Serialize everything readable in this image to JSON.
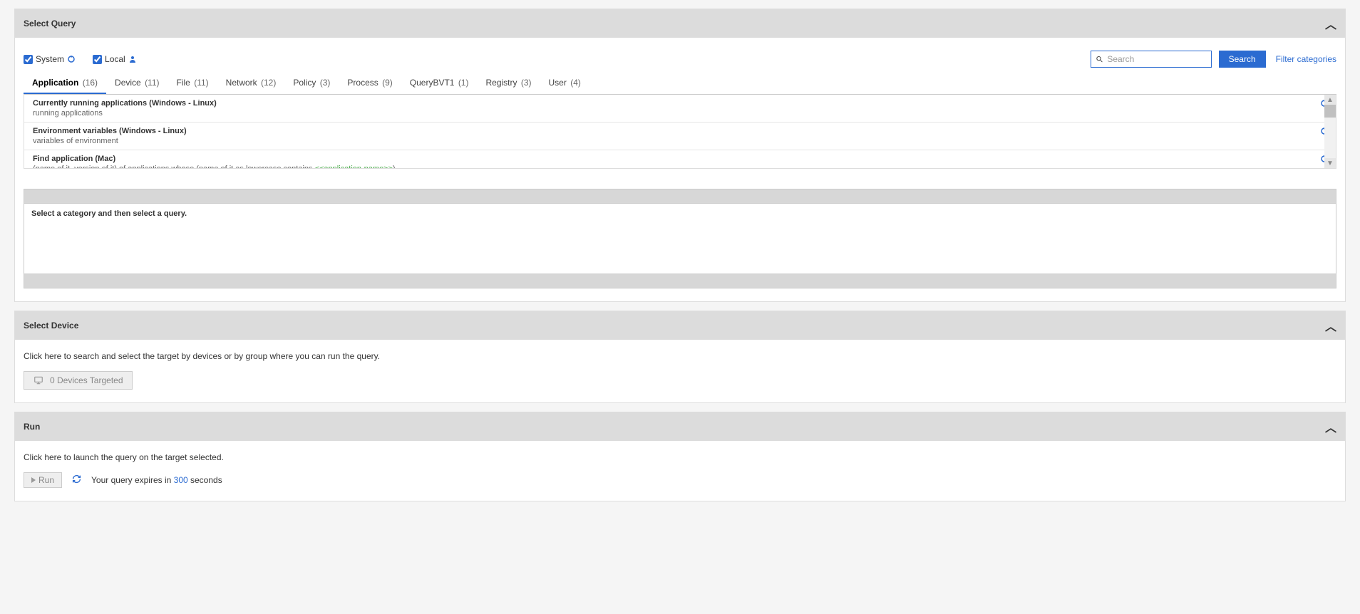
{
  "selectQuery": {
    "title": "Select Query",
    "system_label": "System",
    "local_label": "Local",
    "search_placeholder": "Search",
    "search_button": "Search",
    "filter_link": "Filter categories",
    "tabs": [
      {
        "label": "Application",
        "count": "(16)",
        "active": true
      },
      {
        "label": "Device",
        "count": "(11)"
      },
      {
        "label": "File",
        "count": "(11)"
      },
      {
        "label": "Network",
        "count": "(12)"
      },
      {
        "label": "Policy",
        "count": "(3)"
      },
      {
        "label": "Process",
        "count": "(9)"
      },
      {
        "label": "QueryBVT1",
        "count": "(1)"
      },
      {
        "label": "Registry",
        "count": "(3)"
      },
      {
        "label": "User",
        "count": "(4)"
      }
    ],
    "queries": [
      {
        "title": "Currently running applications (Windows - Linux)",
        "desc": "running applications"
      },
      {
        "title": "Environment variables (Windows - Linux)",
        "desc": "variables of environment"
      },
      {
        "title": "Find application (Mac)",
        "desc_prefix": "(name of it, version of it) of applications whose (name of it as lowercase contains ",
        "desc_placeholder": "<<application-name>>",
        "desc_suffix": ")"
      }
    ],
    "editor_hint": "Select a category and then select a query."
  },
  "selectDevice": {
    "title": "Select Device",
    "hint": "Click here to search and select the target by devices or by group where you can run the query.",
    "button": "0 Devices Targeted"
  },
  "run": {
    "title": "Run",
    "hint": "Click here to launch the query on the target selected.",
    "button": "Run",
    "expire_prefix": "Your query expires in ",
    "expire_seconds": "300",
    "expire_suffix": " seconds"
  }
}
